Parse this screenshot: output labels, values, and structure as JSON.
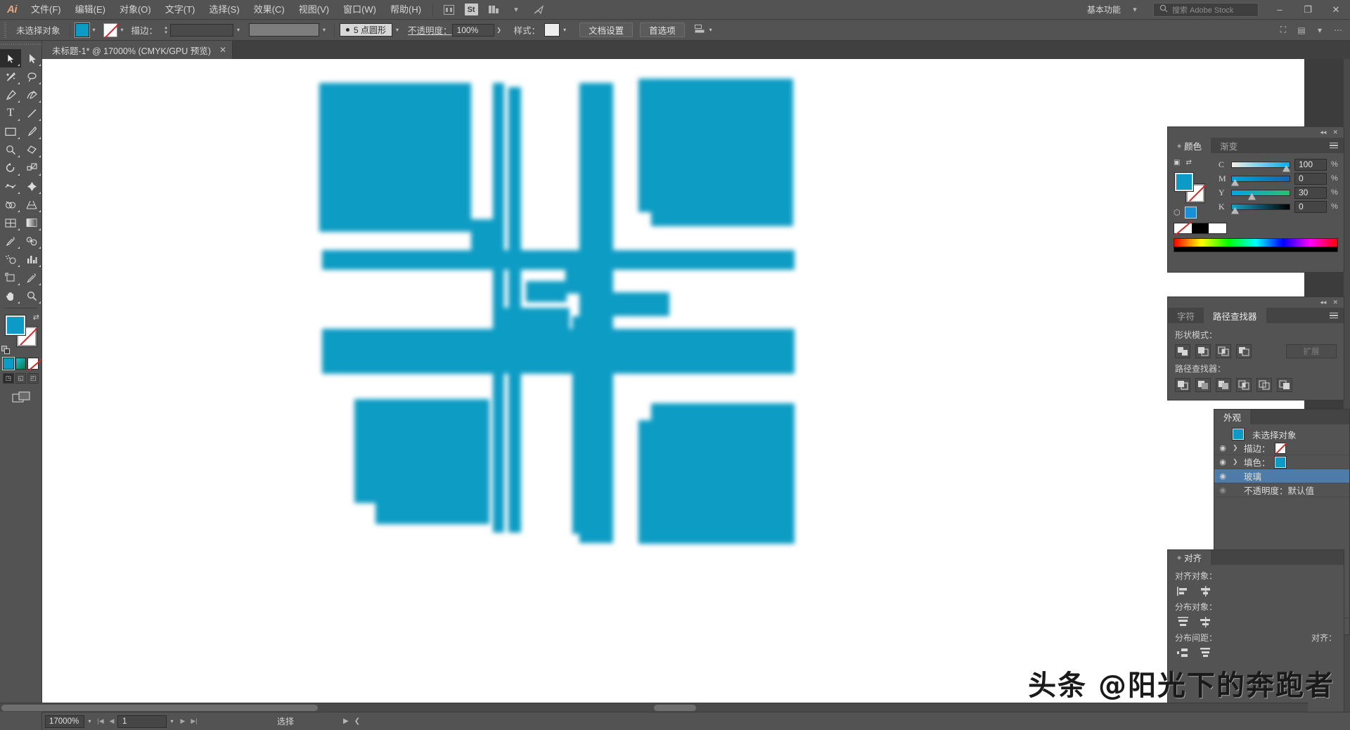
{
  "app": {
    "name": "Adobe Illustrator",
    "logo": "Ai"
  },
  "menubar": {
    "items": [
      {
        "label": "文件(F)",
        "name": "menu-file"
      },
      {
        "label": "编辑(E)",
        "name": "menu-edit"
      },
      {
        "label": "对象(O)",
        "name": "menu-object"
      },
      {
        "label": "文字(T)",
        "name": "menu-type"
      },
      {
        "label": "选择(S)",
        "name": "menu-select"
      },
      {
        "label": "效果(C)",
        "name": "menu-effect"
      },
      {
        "label": "视图(V)",
        "name": "menu-view"
      },
      {
        "label": "窗口(W)",
        "name": "menu-window"
      },
      {
        "label": "帮助(H)",
        "name": "menu-help"
      }
    ],
    "bridge_icon": "bridge-icon",
    "stock_badge": "St",
    "arrange_icon": "arrange-documents-icon",
    "share_icon": "share-icon",
    "workspace": "基本功能",
    "search_placeholder": "搜索 Adobe Stock",
    "window_buttons": {
      "minimize": "–",
      "maximize": "❐",
      "close": "✕"
    }
  },
  "controlbar": {
    "selection_status": "未选择对象",
    "fill_color": "#0b9bc6",
    "stroke_swatch": "none",
    "stroke_label": "描边：",
    "stroke_weight": "",
    "stroke_profile": "5 点圆形",
    "opacity_label": "不透明度：",
    "opacity_value": "100%",
    "style_label": "样式：",
    "doc_setup_button": "文档设置",
    "preferences_button": "首选项",
    "align_icon": "align-to-icon"
  },
  "tabbar": {
    "document_tab": "未标题-1* @ 17000% (CMYK/GPU 预览)",
    "close_glyph": "✕"
  },
  "toolbar": {
    "tools": [
      {
        "name": "selection-tool",
        "glyph": "➤",
        "active": true
      },
      {
        "name": "direct-selection-tool",
        "glyph": "➤",
        "active": false
      },
      {
        "name": "magic-wand-tool",
        "glyph": "✨",
        "active": false
      },
      {
        "name": "lasso-tool",
        "glyph": "⟲",
        "active": false
      },
      {
        "name": "pen-tool",
        "glyph": "✒",
        "active": false
      },
      {
        "name": "curvature-tool",
        "glyph": "∿",
        "active": false
      },
      {
        "name": "type-tool",
        "glyph": "T",
        "active": false
      },
      {
        "name": "line-segment-tool",
        "glyph": "╱",
        "active": false
      },
      {
        "name": "rectangle-tool",
        "glyph": "▭",
        "active": false
      },
      {
        "name": "paintbrush-tool",
        "glyph": "✎",
        "active": false
      },
      {
        "name": "shaper-tool",
        "glyph": "◔",
        "active": false
      },
      {
        "name": "eraser-tool",
        "glyph": "◆",
        "active": false
      },
      {
        "name": "rotate-tool",
        "glyph": "↺",
        "active": false
      },
      {
        "name": "scale-tool",
        "glyph": "⤢",
        "active": false
      },
      {
        "name": "width-tool",
        "glyph": "≈",
        "active": false
      },
      {
        "name": "free-transform-tool",
        "glyph": "✧",
        "active": false
      },
      {
        "name": "shape-builder-tool",
        "glyph": "◎",
        "active": false
      },
      {
        "name": "perspective-grid-tool",
        "glyph": "◧",
        "active": false
      },
      {
        "name": "mesh-tool",
        "glyph": "⊞",
        "active": false
      },
      {
        "name": "gradient-tool",
        "glyph": "▤",
        "active": false
      },
      {
        "name": "eyedropper-tool",
        "glyph": "⚗",
        "active": false
      },
      {
        "name": "blend-tool",
        "glyph": "◑",
        "active": false
      },
      {
        "name": "symbol-sprayer-tool",
        "glyph": "⁘",
        "active": false
      },
      {
        "name": "column-graph-tool",
        "glyph": "█",
        "active": false
      },
      {
        "name": "artboard-tool",
        "glyph": "⌑",
        "active": false
      },
      {
        "name": "slice-tool",
        "glyph": "✂",
        "active": false
      },
      {
        "name": "hand-tool",
        "glyph": "✋",
        "active": false
      },
      {
        "name": "zoom-tool",
        "glyph": "⌕",
        "active": false
      }
    ],
    "fill_color": "#0b9bc6",
    "stroke_color": "none",
    "color_modes": [
      "color",
      "gradient",
      "none"
    ],
    "draw_modes": [
      "draw-normal",
      "draw-behind",
      "draw-inside"
    ],
    "screen_mode": "change-screen-mode"
  },
  "canvas": {
    "artwork_color": "#0d9cc4",
    "zoom": "17000%"
  },
  "panels": {
    "color": {
      "tabs": [
        {
          "label": "颜色",
          "active": true
        },
        {
          "label": "渐变",
          "active": false
        }
      ],
      "model": "CMYK",
      "channels": [
        {
          "label": "C",
          "value": "100",
          "unit": "%",
          "pos": 100
        },
        {
          "label": "M",
          "value": "0",
          "unit": "%",
          "pos": 0
        },
        {
          "label": "Y",
          "value": "30",
          "unit": "%",
          "pos": 30
        },
        {
          "label": "K",
          "value": "0",
          "unit": "%",
          "pos": 0
        }
      ],
      "fill": "#0b9bc6",
      "stroke": "none"
    },
    "pathfinder": {
      "tabs": [
        {
          "label": "字符",
          "active": false
        },
        {
          "label": "路径查找器",
          "active": true
        }
      ],
      "shape_modes_label": "形状模式：",
      "shape_modes": [
        "unite",
        "minus-front",
        "intersect",
        "exclude"
      ],
      "expand_button": "扩展",
      "pathfinders_label": "路径查找器：",
      "pathfinders": [
        "divide",
        "trim",
        "merge",
        "crop",
        "outline",
        "minus-back"
      ]
    },
    "appearance": {
      "tabs": [
        {
          "label": "外观",
          "active": true
        }
      ],
      "target": "未选择对象",
      "rows": [
        {
          "label": "描边：",
          "type": "stroke",
          "visible": true,
          "expandable": true,
          "selected": false
        },
        {
          "label": "填色：",
          "type": "fill",
          "visible": true,
          "expandable": true,
          "selected": false
        },
        {
          "label": "玻璃",
          "type": "effect",
          "visible": true,
          "expandable": false,
          "selected": true
        },
        {
          "label": "不透明度：默认值",
          "type": "opacity",
          "visible": false,
          "expandable": false,
          "selected": false
        }
      ],
      "footer_icons": [
        "add-new-stroke",
        "add-new-fill",
        "add-new-effect",
        "clear-appearance",
        "duplicate-item",
        "delete-item"
      ]
    },
    "align": {
      "tabs": [
        {
          "label": "对齐",
          "active": true
        }
      ],
      "align_objects_label": "对齐对象：",
      "distribute_objects_label": "分布对象：",
      "distribute_spacing_label": "分布间距：",
      "align_to_label": "对齐："
    }
  },
  "statusbar": {
    "zoom_value": "17000%",
    "page_value": "1",
    "status_text": "选择"
  },
  "watermark": {
    "text": "头条 @阳光下的奔跑者"
  }
}
